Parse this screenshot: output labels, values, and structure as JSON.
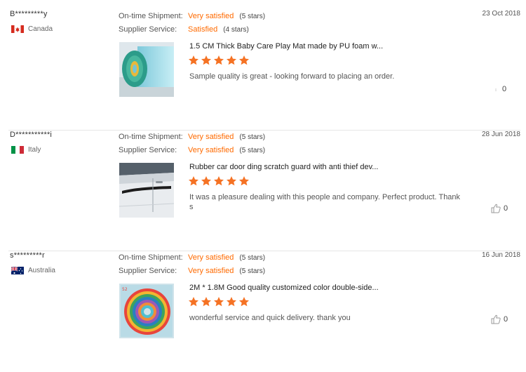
{
  "colors": {
    "accent": "#ff6a00",
    "star": "#f57224",
    "divider": "#e6e6e6"
  },
  "reviews": [
    {
      "buyer": "B*********y",
      "country": "Canada",
      "flag_icon": "canada-flag-icon",
      "date": "23 Oct 2018",
      "shipment_label": "On-time Shipment:",
      "shipment_value": "Very satisfied",
      "shipment_stars": "(5 stars)",
      "service_label": "Supplier Service:",
      "service_value": "Satisfied",
      "service_stars": "(4 stars)",
      "product_title": "1.5 CM Thick Baby Care Play Mat made by PU foam w...",
      "rating": 5,
      "comment": "Sample quality is great - looking forward to placing an order.",
      "likes": "0",
      "thumb_icon": "rolled-play-mat-image"
    },
    {
      "buyer": "D***********i",
      "country": "Italy",
      "flag_icon": "italy-flag-icon",
      "date": "28 Jun 2018",
      "shipment_label": "On-time Shipment:",
      "shipment_value": "Very satisfied",
      "shipment_stars": "(5 stars)",
      "service_label": "Supplier Service:",
      "service_value": "Very satisfied",
      "service_stars": "(5 stars)",
      "product_title": "Rubber car door ding scratch guard with anti thief dev...",
      "rating": 5,
      "comment": "It was a pleasure dealing with this people and company. Perfect product. Thanks",
      "likes": "0",
      "thumb_icon": "car-door-guard-image"
    },
    {
      "buyer": "s*********r",
      "country": "Australia",
      "flag_icon": "australia-flag-icon",
      "date": "16 Jun 2018",
      "shipment_label": "On-time Shipment:",
      "shipment_value": "Very satisfied",
      "shipment_stars": "(5 stars)",
      "service_label": "Supplier Service:",
      "service_value": "Very satisfied",
      "service_stars": "(5 stars)",
      "product_title": "2M * 1.8M Good quality customized color double-side...",
      "rating": 5,
      "comment": "wonderful service and quick delivery. thank you",
      "likes": "0",
      "thumb_icon": "colorful-mat-roll-image"
    }
  ]
}
